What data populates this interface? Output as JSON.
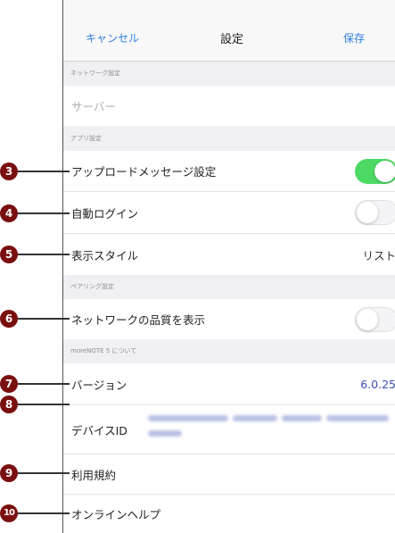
{
  "navbar": {
    "cancel_label": "キャンセル",
    "title": "設定",
    "save_label": "保存"
  },
  "sections": {
    "network": "ネットワーク設定",
    "app": "アプリ設定",
    "pairing": "ペアリング設定",
    "about": "moreNOTE 5 について"
  },
  "rows": {
    "server": {
      "placeholder": "サーバー"
    },
    "upload_message": {
      "label": "アップロードメッセージ設定",
      "toggle_on": true
    },
    "auto_login": {
      "label": "自動ログイン",
      "toggle_on": false
    },
    "display_style": {
      "label": "表示スタイル",
      "value": "リスト"
    },
    "network_quality": {
      "label": "ネットワークの品質を表示",
      "toggle_on": false
    },
    "version": {
      "label": "バージョン",
      "value": "6.0.25"
    },
    "device_id": {
      "label": "デバイスID"
    },
    "terms": {
      "label": "利用規約"
    },
    "online_help": {
      "label": "オンラインヘルプ"
    }
  },
  "callouts": [
    "3",
    "4",
    "5",
    "6",
    "7",
    "8",
    "9",
    "10"
  ],
  "colors": {
    "accent_blue": "#2f7fe6",
    "toggle_on": "#4cd964",
    "callout_badge": "#7a0f10",
    "version_text": "#3d4fb3"
  }
}
